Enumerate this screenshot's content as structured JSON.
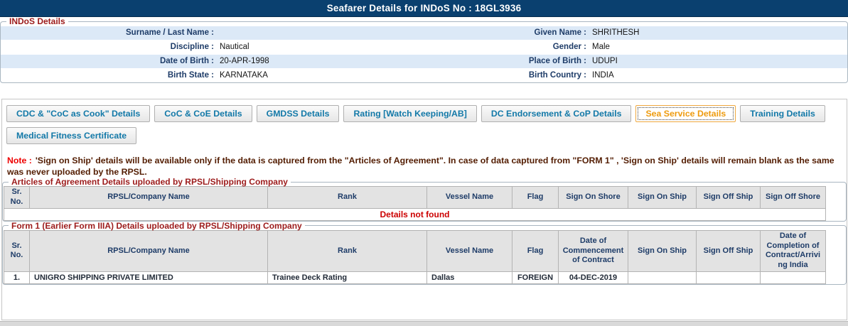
{
  "page": {
    "title": "Seafarer Details for INDoS No : 18GL3936"
  },
  "colors": {
    "titlebar_bg": "#0a406f",
    "label_navy": "#1e3c68",
    "legend_maroon": "#9c1b1b",
    "tab_text_blue": "#1379a8",
    "active_tab_orange": "#ee9b0e",
    "note_red": "#ee0000",
    "note_body_maroon": "#531d02",
    "row_stripe_blue": "#dce9f7",
    "table_header_bg": "#e3e3e3",
    "error_red": "#cc0000"
  },
  "indos": {
    "legend": "INDoS Details",
    "rows": [
      {
        "l_label": "Surname / Last Name :",
        "l_value": "",
        "r_label": "Given Name :",
        "r_value": "SHRITHESH"
      },
      {
        "l_label": "Discipline :",
        "l_value": "Nautical",
        "r_label": "Gender :",
        "r_value": "Male"
      },
      {
        "l_label": "Date of Birth :",
        "l_value": "20-APR-1998",
        "r_label": "Place of Birth :",
        "r_value": "UDUPI"
      },
      {
        "l_label": "Birth State :",
        "l_value": "KARNATAKA",
        "r_label": "Birth Country :",
        "r_value": "INDIA"
      }
    ]
  },
  "tabs": {
    "active": "Sea Service Details",
    "row1": [
      "CDC & \"CoC as Cook\" Details",
      "CoC & CoE Details",
      "GMDSS Details",
      "Rating [Watch Keeping/AB]",
      "DC Endorsement & CoP Details",
      "Sea Service Details",
      "Training Details"
    ],
    "row2": [
      "Medical Fitness Certificate"
    ]
  },
  "note": {
    "prefix": "Note :",
    "body": "'Sign on Ship' details will be available only if the data is captured from the \"Articles of Agreement\". In case of data captured from \"FORM 1\" , 'Sign on Ship' details will remain blank as the same was never uploaded by the RPSL."
  },
  "tables": {
    "agreement": {
      "legend": "Articles of Agreement Details uploaded by RPSL/Shipping Company",
      "headers": [
        "Sr. No.",
        "RPSL/Company Name",
        "Rank",
        "Vessel Name",
        "Flag",
        "Sign On Shore",
        "Sign On Ship",
        "Sign Off Ship",
        "Sign Off Shore"
      ],
      "empty_message": "Details not found"
    },
    "form1": {
      "legend": "Form 1 (Earlier Form IIIA) Details uploaded by RPSL/Shipping Company",
      "headers": [
        "Sr. No.",
        "RPSL/Company Name",
        "Rank",
        "Vessel Name",
        "Flag",
        "Date of Commencement of Contract",
        "Sign On Ship",
        "Sign Off Ship",
        "Date of Completion of Contract/Arriving India"
      ],
      "rows": [
        [
          "1.",
          "UNIGRO SHIPPING PRIVATE LIMITED",
          "Trainee Deck Rating",
          "Dallas",
          "FOREIGN",
          "04-DEC-2019",
          "",
          "",
          ""
        ]
      ]
    }
  }
}
